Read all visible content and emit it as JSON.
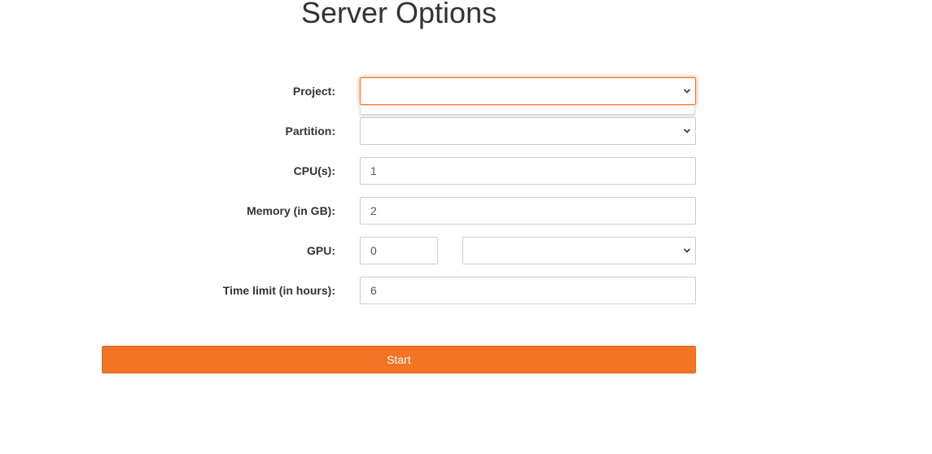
{
  "page": {
    "title": "Server Options"
  },
  "form": {
    "project": {
      "label": "Project:",
      "value": ""
    },
    "partition": {
      "label": "Partition:",
      "value": ""
    },
    "cpus": {
      "label": "CPU(s):",
      "value": "1"
    },
    "memory": {
      "label": "Memory (in GB):",
      "value": "2"
    },
    "gpu": {
      "label": "GPU:",
      "count_value": "0",
      "type_value": ""
    },
    "time_limit": {
      "label": "Time limit (in hours):",
      "value": "6"
    }
  },
  "actions": {
    "start_label": "Start"
  },
  "colors": {
    "accent": "#f37524",
    "text": "#333333",
    "border": "#cccccc"
  },
  "icons": {
    "select_arrow": "chevron-down-icon"
  }
}
